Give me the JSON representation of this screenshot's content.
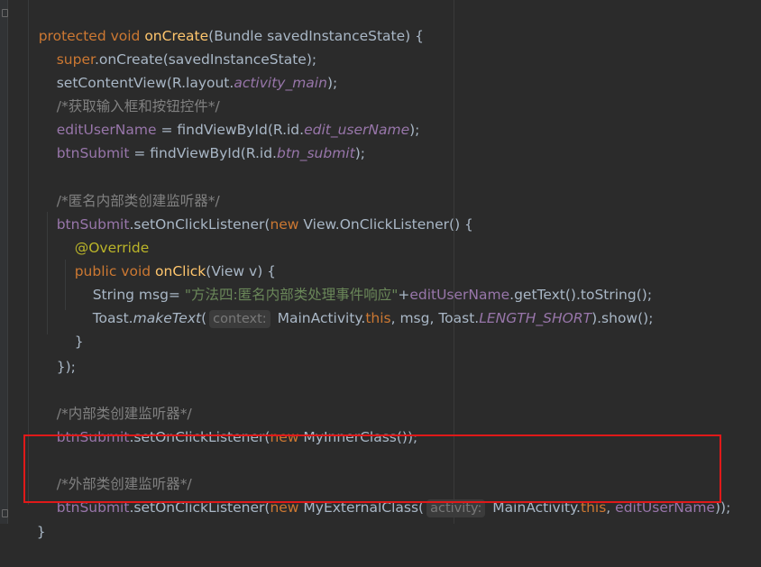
{
  "colors": {
    "background": "#2b2b2b",
    "keyword": "#cc7832",
    "method_decl": "#ffc66d",
    "field": "#9876aa",
    "comment": "#808080",
    "string": "#6a8759",
    "annotation": "#bbb529",
    "highlight_box": "#e01919"
  },
  "code": {
    "l1": {
      "kw": "protected void ",
      "fn": "onCreate",
      "rest": "(Bundle savedInstanceState) {"
    },
    "l2": {
      "kw": "super",
      "rest": ".onCreate(savedInstanceState);"
    },
    "l3": {
      "a": "setContentView(R.layout.",
      "b": "activity_main",
      "c": ");"
    },
    "l4": {
      "cm": "/*获取输入框和按钮控件*/"
    },
    "l5": {
      "f": "editUserName",
      "a": " = findViewById(R.id.",
      "b": "edit_userName",
      "c": ");"
    },
    "l6": {
      "f": "btnSubmit",
      "a": " = findViewById(R.id.",
      "b": "btn_submit",
      "c": ");"
    },
    "l7": {
      "cm": "/*匿名内部类创建监听器*/"
    },
    "l8": {
      "f": "btnSubmit",
      "a": ".setOnClickListener(",
      "kw": "new",
      "b": " View.OnClickListener() {"
    },
    "l9": {
      "ann": "@Override"
    },
    "l10": {
      "kw": "public void ",
      "fn": "onClick",
      "rest": "(View v) {"
    },
    "l11": {
      "a": "String msg= ",
      "str": "\"方法四:匿名内部类处理事件响应\"",
      "b": "+",
      "f": "editUserName",
      "c": ".getText().toString();"
    },
    "l12": {
      "a": "Toast.",
      "b": "makeText",
      "c": "(",
      "hint": "context:",
      "d": " MainActivity.",
      "kw": "this",
      "e": ", msg, Toast.",
      "f": "LENGTH_SHORT",
      "g": ").show();"
    },
    "l13": {
      "rest": "}"
    },
    "l14": {
      "rest": "});"
    },
    "l15": {
      "cm": "/*内部类创建监听器*/"
    },
    "l16": {
      "f": "btnSubmit",
      "a": ".setOnClickListener(",
      "kw": "new",
      "b": " MyInnerClass());"
    },
    "l17": {
      "cm": "/*外部类创建监听器*/"
    },
    "l18": {
      "f": "btnSubmit",
      "a": ".setOnClickListener(",
      "kw": "new",
      "b": " MyExternalClass(",
      "hint": "activity:",
      "c": " MainActivity.",
      "kw2": "this",
      "d": ", ",
      "f2": "editUserName",
      "e": "));"
    },
    "l19": {
      "rest": "}"
    }
  }
}
